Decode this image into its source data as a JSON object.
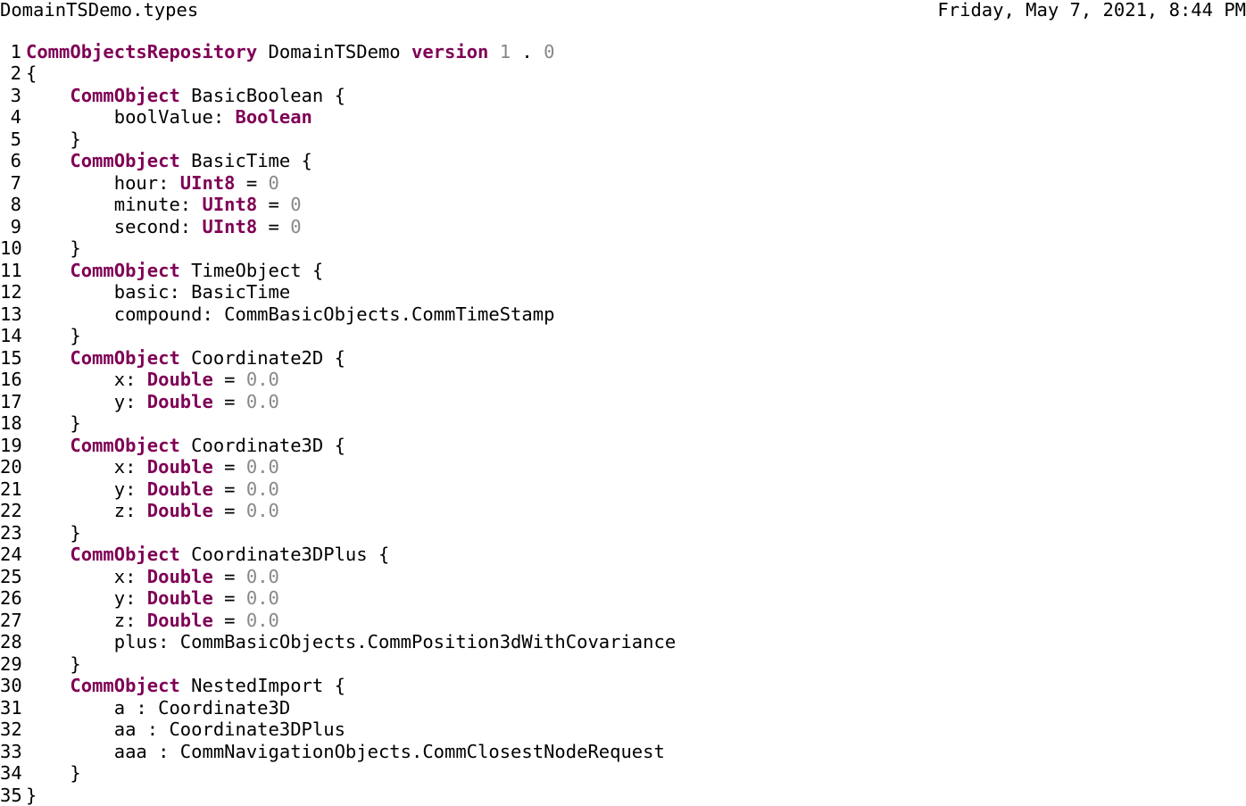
{
  "header": {
    "file_name": "DomainTSDemo.types",
    "date_time": "Friday, May 7, 2021, 8:44 PM"
  },
  "colors": {
    "keyword": "#7f0055",
    "number": "#888888",
    "text": "#000000"
  },
  "code": {
    "lines": [
      [
        {
          "t": "CommObjectsRepository",
          "k": "kw"
        },
        {
          "t": " DomainTSDemo "
        },
        {
          "t": "version",
          "k": "kw"
        },
        {
          "t": " "
        },
        {
          "t": "1",
          "k": "num"
        },
        {
          "t": " . "
        },
        {
          "t": "0",
          "k": "num"
        }
      ],
      [
        {
          "t": "{"
        }
      ],
      [
        {
          "t": "    "
        },
        {
          "t": "CommObject",
          "k": "kw"
        },
        {
          "t": " BasicBoolean {"
        }
      ],
      [
        {
          "t": "        boolValue: "
        },
        {
          "t": "Boolean",
          "k": "kw"
        }
      ],
      [
        {
          "t": "    }"
        }
      ],
      [
        {
          "t": "    "
        },
        {
          "t": "CommObject",
          "k": "kw"
        },
        {
          "t": " BasicTime {"
        }
      ],
      [
        {
          "t": "        hour: "
        },
        {
          "t": "UInt8",
          "k": "kw"
        },
        {
          "t": " = "
        },
        {
          "t": "0",
          "k": "num"
        }
      ],
      [
        {
          "t": "        minute: "
        },
        {
          "t": "UInt8",
          "k": "kw"
        },
        {
          "t": " = "
        },
        {
          "t": "0",
          "k": "num"
        }
      ],
      [
        {
          "t": "        second: "
        },
        {
          "t": "UInt8",
          "k": "kw"
        },
        {
          "t": " = "
        },
        {
          "t": "0",
          "k": "num"
        }
      ],
      [
        {
          "t": "    }"
        }
      ],
      [
        {
          "t": "    "
        },
        {
          "t": "CommObject",
          "k": "kw"
        },
        {
          "t": " TimeObject {"
        }
      ],
      [
        {
          "t": "        basic: BasicTime"
        }
      ],
      [
        {
          "t": "        compound: CommBasicObjects.CommTimeStamp"
        }
      ],
      [
        {
          "t": "    }"
        }
      ],
      [
        {
          "t": "    "
        },
        {
          "t": "CommObject",
          "k": "kw"
        },
        {
          "t": " Coordinate2D {"
        }
      ],
      [
        {
          "t": "        x: "
        },
        {
          "t": "Double",
          "k": "kw"
        },
        {
          "t": " = "
        },
        {
          "t": "0.0",
          "k": "num"
        }
      ],
      [
        {
          "t": "        y: "
        },
        {
          "t": "Double",
          "k": "kw"
        },
        {
          "t": " = "
        },
        {
          "t": "0.0",
          "k": "num"
        }
      ],
      [
        {
          "t": "    }"
        }
      ],
      [
        {
          "t": "    "
        },
        {
          "t": "CommObject",
          "k": "kw"
        },
        {
          "t": " Coordinate3D {"
        }
      ],
      [
        {
          "t": "        x: "
        },
        {
          "t": "Double",
          "k": "kw"
        },
        {
          "t": " = "
        },
        {
          "t": "0.0",
          "k": "num"
        }
      ],
      [
        {
          "t": "        y: "
        },
        {
          "t": "Double",
          "k": "kw"
        },
        {
          "t": " = "
        },
        {
          "t": "0.0",
          "k": "num"
        }
      ],
      [
        {
          "t": "        z: "
        },
        {
          "t": "Double",
          "k": "kw"
        },
        {
          "t": " = "
        },
        {
          "t": "0.0",
          "k": "num"
        }
      ],
      [
        {
          "t": "    }"
        }
      ],
      [
        {
          "t": "    "
        },
        {
          "t": "CommObject",
          "k": "kw"
        },
        {
          "t": " Coordinate3DPlus {"
        }
      ],
      [
        {
          "t": "        x: "
        },
        {
          "t": "Double",
          "k": "kw"
        },
        {
          "t": " = "
        },
        {
          "t": "0.0",
          "k": "num"
        }
      ],
      [
        {
          "t": "        y: "
        },
        {
          "t": "Double",
          "k": "kw"
        },
        {
          "t": " = "
        },
        {
          "t": "0.0",
          "k": "num"
        }
      ],
      [
        {
          "t": "        z: "
        },
        {
          "t": "Double",
          "k": "kw"
        },
        {
          "t": " = "
        },
        {
          "t": "0.0",
          "k": "num"
        }
      ],
      [
        {
          "t": "        plus: CommBasicObjects.CommPosition3dWithCovariance"
        }
      ],
      [
        {
          "t": "    }"
        }
      ],
      [
        {
          "t": "    "
        },
        {
          "t": "CommObject",
          "k": "kw"
        },
        {
          "t": " NestedImport {"
        }
      ],
      [
        {
          "t": "        a : Coordinate3D"
        }
      ],
      [
        {
          "t": "        aa : Coordinate3DPlus"
        }
      ],
      [
        {
          "t": "        aaa : CommNavigationObjects.CommClosestNodeRequest"
        }
      ],
      [
        {
          "t": "    }"
        }
      ],
      [
        {
          "t": "}"
        }
      ]
    ]
  }
}
